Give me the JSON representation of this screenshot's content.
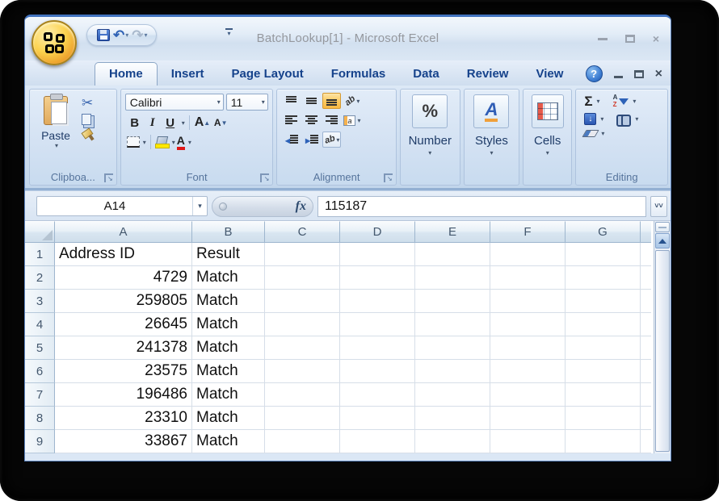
{
  "window": {
    "title": "BatchLookup[1] - Microsoft Excel"
  },
  "tabs": {
    "items": [
      "Home",
      "Insert",
      "Page Layout",
      "Formulas",
      "Data",
      "Review",
      "View"
    ]
  },
  "ribbon": {
    "clipboard": {
      "label": "Clipboa...",
      "paste": "Paste"
    },
    "font": {
      "label": "Font",
      "name": "Calibri",
      "size": "11",
      "bold": "B",
      "italic": "I",
      "underline": "U"
    },
    "alignment": {
      "label": "Alignment"
    },
    "number": {
      "label": "Number",
      "icon": "%"
    },
    "styles": {
      "label": "Styles"
    },
    "cells": {
      "label": "Cells"
    },
    "editing": {
      "label": "Editing",
      "sigma": "Σ"
    }
  },
  "formula_bar": {
    "name_box": "A14",
    "fx": "fx",
    "value": "115187"
  },
  "grid": {
    "columns": [
      "A",
      "B",
      "C",
      "D",
      "E",
      "F",
      "G"
    ],
    "rows": [
      {
        "n": "1",
        "a": "Address ID",
        "b": "Result"
      },
      {
        "n": "2",
        "a": "4729",
        "b": "Match"
      },
      {
        "n": "3",
        "a": "259805",
        "b": "Match"
      },
      {
        "n": "4",
        "a": "26645",
        "b": "Match"
      },
      {
        "n": "5",
        "a": "241378",
        "b": "Match"
      },
      {
        "n": "6",
        "a": "23575",
        "b": "Match"
      },
      {
        "n": "7",
        "a": "196486",
        "b": "Match"
      },
      {
        "n": "8",
        "a": "23310",
        "b": "Match"
      },
      {
        "n": "9",
        "a": "33867",
        "b": "Match"
      }
    ]
  },
  "icons": {
    "dropdown": "▾",
    "undo": "↶",
    "redo": "↷",
    "scissors": "✂",
    "close": "×",
    "help": "?",
    "launcher": "↘",
    "down_arrow": "↓",
    "chevrons": "˅˅",
    "orientation": "ab",
    "merge": "a",
    "wrap": "ab"
  }
}
